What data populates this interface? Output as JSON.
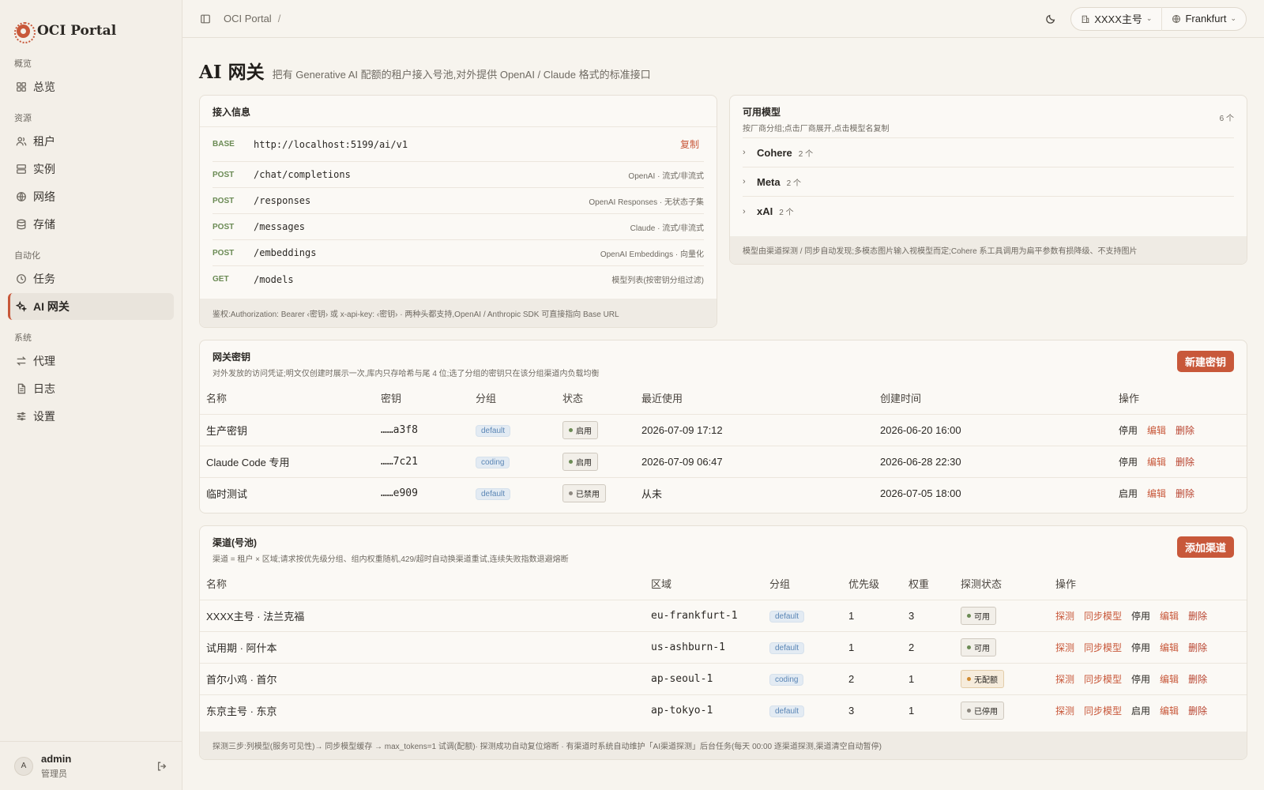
{
  "sidebar": {
    "brand": "OCI Portal",
    "groups": [
      {
        "title": "概览",
        "items": [
          {
            "label": "总览",
            "icon": "grid-icon"
          }
        ]
      },
      {
        "title": "资源",
        "items": [
          {
            "label": "租户",
            "icon": "users-icon"
          },
          {
            "label": "实例",
            "icon": "server-icon"
          },
          {
            "label": "网络",
            "icon": "globe-icon"
          },
          {
            "label": "存储",
            "icon": "database-icon"
          }
        ]
      },
      {
        "title": "自动化",
        "items": [
          {
            "label": "任务",
            "icon": "clock-icon"
          },
          {
            "label": "AI 网关",
            "icon": "sparkle-icon",
            "active": true
          }
        ]
      },
      {
        "title": "系统",
        "items": [
          {
            "label": "代理",
            "icon": "swap-icon"
          },
          {
            "label": "日志",
            "icon": "file-icon"
          },
          {
            "label": "设置",
            "icon": "sliders-icon"
          }
        ]
      }
    ],
    "user": {
      "initial": "A",
      "name": "admin",
      "role": "管理员"
    }
  },
  "topbar": {
    "breadcrumb": "OCI Portal",
    "separator": "/",
    "tenant": "XXXX主号",
    "region": "Frankfurt"
  },
  "page": {
    "title": "AI 网关",
    "subtitle": "把有 Generative AI 配额的租户接入号池,对外提供 OpenAI / Claude 格式的标准接口"
  },
  "access": {
    "title": "接入信息",
    "base_label": "BASE",
    "base_url": "http://localhost:5199/ai/v1",
    "copy_label": "复制",
    "endpoints": [
      {
        "method": "POST",
        "path": "/chat/completions",
        "note": "OpenAI · 流式/非流式"
      },
      {
        "method": "POST",
        "path": "/responses",
        "note": "OpenAI Responses · 无状态子集"
      },
      {
        "method": "POST",
        "path": "/messages",
        "note": "Claude · 流式/非流式"
      },
      {
        "method": "POST",
        "path": "/embeddings",
        "note": "OpenAI Embeddings · 向量化"
      },
      {
        "method": "GET",
        "path": "/models",
        "note": "模型列表(按密钥分组过滤)"
      }
    ],
    "footer": "鉴权:Authorization: Bearer ‹密钥› 或 x-api-key: ‹密钥› · 两种头都支持,OpenAI / Anthropic SDK 可直接指向 Base URL"
  },
  "models": {
    "title": "可用模型",
    "desc": "按厂商分组;点击厂商展开,点击模型名复制",
    "count": "6 个",
    "vendors": [
      {
        "name": "Cohere",
        "count": "2 个"
      },
      {
        "name": "Meta",
        "count": "2 个"
      },
      {
        "name": "xAI",
        "count": "2 个"
      }
    ],
    "footer": "模型由渠道探测 / 同步自动发现;多模态图片输入视模型而定;Cohere 系工具调用为扁平参数有损降级、不支持图片"
  },
  "keys": {
    "title": "网关密钥",
    "desc": "对外发放的访问凭证;明文仅创建时展示一次,库内只存哈希与尾 4 位;选了分组的密钥只在该分组渠道内负载均衡",
    "new_button": "新建密钥",
    "columns": [
      "名称",
      "密钥",
      "分组",
      "状态",
      "最近使用",
      "创建时间",
      "操作"
    ],
    "rows": [
      {
        "name": "生产密钥",
        "key": "……a3f8",
        "group": "default",
        "status": "启用",
        "last_used": "2026-07-09 17:12",
        "created": "2026-06-20 16:00",
        "toggle": "停用",
        "edit": "编辑",
        "delete": "删除"
      },
      {
        "name": "Claude Code 专用",
        "key": "……7c21",
        "group": "coding",
        "status": "启用",
        "last_used": "2026-07-09 06:47",
        "created": "2026-06-28 22:30",
        "toggle": "停用",
        "edit": "编辑",
        "delete": "删除"
      },
      {
        "name": "临时测试",
        "key": "……e909",
        "group": "default",
        "status": "已禁用",
        "last_used": "从未",
        "created": "2026-07-05 18:00",
        "toggle": "启用",
        "edit": "编辑",
        "delete": "删除"
      }
    ]
  },
  "channels": {
    "title": "渠道(号池)",
    "desc": "渠道 = 租户 × 区域;请求按优先级分组、组内权重随机,429/超时自动换渠道重试,连续失败指数退避熔断",
    "add_button": "添加渠道",
    "columns": [
      "名称",
      "区域",
      "分组",
      "优先级",
      "权重",
      "探测状态",
      "操作"
    ],
    "rows": [
      {
        "name": "XXXX主号 · 法兰克福",
        "region": "eu-frankfurt-1",
        "group": "default",
        "priority": "1",
        "weight": "3",
        "status": "可用",
        "probe": "探测",
        "sync": "同步模型",
        "toggle": "停用",
        "edit": "编辑",
        "delete": "删除"
      },
      {
        "name": "试用期 · 阿什本",
        "region": "us-ashburn-1",
        "group": "default",
        "priority": "1",
        "weight": "2",
        "status": "可用",
        "probe": "探测",
        "sync": "同步模型",
        "toggle": "停用",
        "edit": "编辑",
        "delete": "删除"
      },
      {
        "name": "首尔小鸡 · 首尔",
        "region": "ap-seoul-1",
        "group": "coding",
        "priority": "2",
        "weight": "1",
        "status": "无配额",
        "probe": "探测",
        "sync": "同步模型",
        "toggle": "停用",
        "edit": "编辑",
        "delete": "删除"
      },
      {
        "name": "东京主号 · 东京",
        "region": "ap-tokyo-1",
        "group": "default",
        "priority": "3",
        "weight": "1",
        "status": "已停用",
        "probe": "探测",
        "sync": "同步模型",
        "toggle": "启用",
        "edit": "编辑",
        "delete": "删除"
      }
    ],
    "footer": "探测三步:列模型(服务可见性)→ 同步模型缓存 → max_tokens=1 试调(配额)· 探测成功自动复位熔断 · 有渠道时系统自动维护「AI渠道探测」后台任务(每天 00:00 逐渠道探测,渠道清空自动暂停)"
  },
  "colors": {
    "accent": "#c8583a",
    "ok": "#6b8b55",
    "warn": "#d08a2f"
  }
}
